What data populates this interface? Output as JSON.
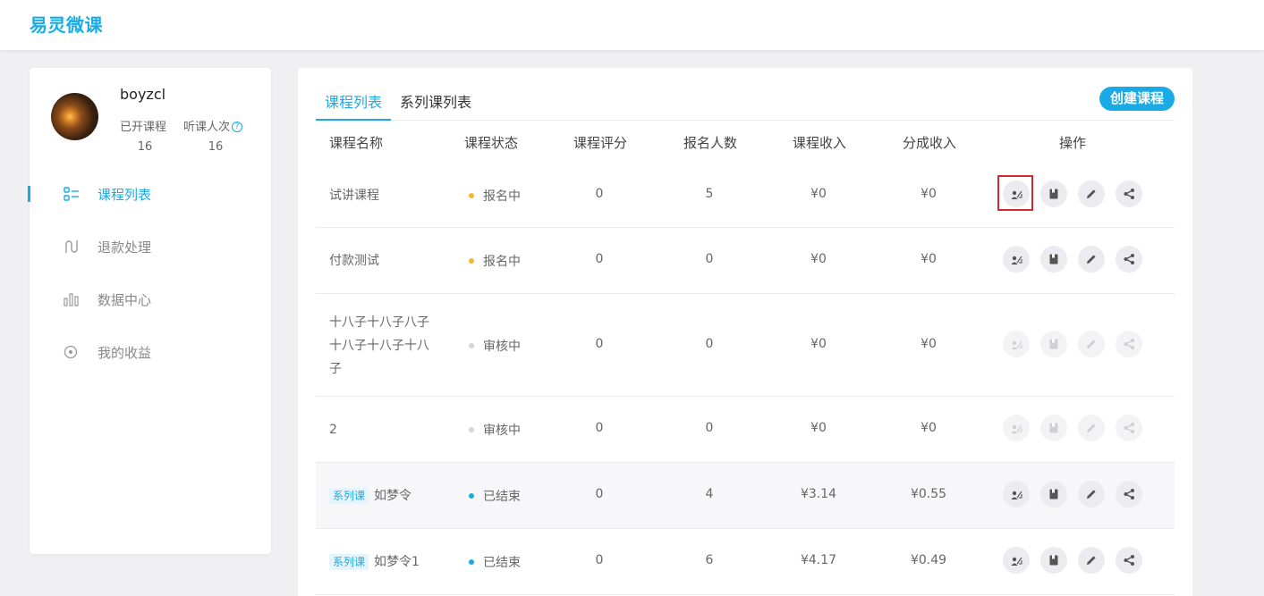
{
  "header": {
    "brand": "易灵微课"
  },
  "profile": {
    "username": "boyzcl",
    "courses_opened_label": "已开课程",
    "listen_count_label": "听课人次",
    "courses_opened": "16",
    "listen_count": "16"
  },
  "sidebar": {
    "items": [
      {
        "label": "课程列表",
        "icon": "list-icon",
        "active": true
      },
      {
        "label": "退款处理",
        "icon": "refund-icon",
        "active": false
      },
      {
        "label": "数据中心",
        "icon": "bar-chart-icon",
        "active": false
      },
      {
        "label": "我的收益",
        "icon": "coin-icon",
        "active": false
      }
    ]
  },
  "tabs": [
    {
      "label": "课程列表"
    },
    {
      "label": "系列课列表"
    }
  ],
  "create_button": "创建课程",
  "table": {
    "headers": [
      "课程名称",
      "课程状态",
      "课程评分",
      "报名人数",
      "课程收入",
      "分成收入",
      "操作"
    ],
    "rows": [
      {
        "name": "试讲课程",
        "tag": "",
        "status": "报名中",
        "status_color": "#f5b731",
        "rating": "0",
        "enrolled": "5",
        "income": "¥0",
        "share": "¥0",
        "ops_enabled": true
      },
      {
        "name": "付款测试",
        "tag": "",
        "status": "报名中",
        "status_color": "#f5b731",
        "rating": "0",
        "enrolled": "0",
        "income": "¥0",
        "share": "¥0",
        "ops_enabled": true
      },
      {
        "name": "十八子十八子八子十八子十八子十八子",
        "tag": "",
        "status": "审核中",
        "status_color": "#d5d5dc",
        "rating": "0",
        "enrolled": "0",
        "income": "¥0",
        "share": "¥0",
        "ops_enabled": false
      },
      {
        "name": "2",
        "tag": "",
        "status": "审核中",
        "status_color": "#d5d5dc",
        "rating": "0",
        "enrolled": "0",
        "income": "¥0",
        "share": "¥0",
        "ops_enabled": false
      },
      {
        "name": "如梦令",
        "tag": "系列课",
        "status": "已结束",
        "status_color": "#1aabe6",
        "rating": "0",
        "enrolled": "4",
        "income": "¥3.14",
        "share": "¥0.55",
        "ops_enabled": true
      },
      {
        "name": "如梦令1",
        "tag": "系列课",
        "status": "已结束",
        "status_color": "#1aabe6",
        "rating": "0",
        "enrolled": "6",
        "income": "¥4.17",
        "share": "¥0.49",
        "ops_enabled": true
      }
    ]
  },
  "colors": {
    "accent": "#1aabe6",
    "highlight": "#d42a2a"
  }
}
